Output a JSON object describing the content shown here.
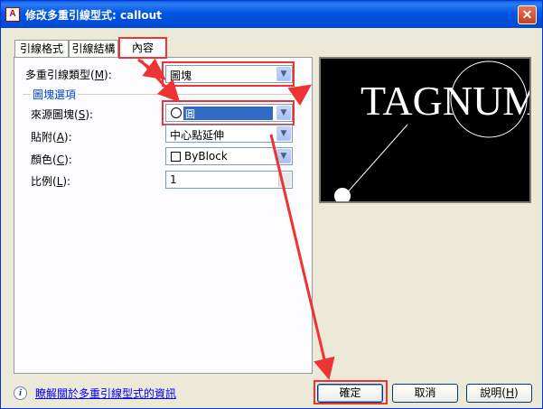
{
  "window": {
    "title": "修改多重引線型式: callout",
    "logo_text": "A",
    "close_glyph": "✕"
  },
  "tabs": [
    {
      "label": "引線格式",
      "active": false
    },
    {
      "label": "引線結構",
      "active": false
    },
    {
      "label": "內容",
      "active": true
    }
  ],
  "content": {
    "multileader_type": {
      "label": "多重引線類型(",
      "hotkey": "M",
      "label_end": "):",
      "value": "圖塊"
    },
    "block_group": {
      "title": "圖塊選項",
      "source_block": {
        "label": "來源圖塊(",
        "hotkey": "S",
        "label_end": "):",
        "value": "圓"
      },
      "attachment": {
        "label": "貼附(",
        "hotkey": "A",
        "label_end": "):",
        "value": "中心點延伸"
      },
      "color": {
        "label": "顏色(",
        "hotkey": "C",
        "label_end": "):",
        "value": "ByBlock"
      },
      "scale": {
        "label": "比例(",
        "hotkey": "L",
        "label_end": "):",
        "value": "1"
      }
    }
  },
  "preview": {
    "text": "TAGNUMI"
  },
  "footer": {
    "info_glyph": "i",
    "help_link": "瞭解關於多重引線型式的資訊",
    "ok": "確定",
    "cancel": "取消",
    "help_btn_prefix": "說明(",
    "help_btn_hotkey": "H",
    "help_btn_suffix": ")"
  },
  "icons": {
    "dropdown": "chevron-down-icon",
    "info": "info-icon",
    "close": "close-icon"
  },
  "colors": {
    "annotation": "#EE3333",
    "title_bar": "#0054E3",
    "selection": "#316AC5"
  }
}
